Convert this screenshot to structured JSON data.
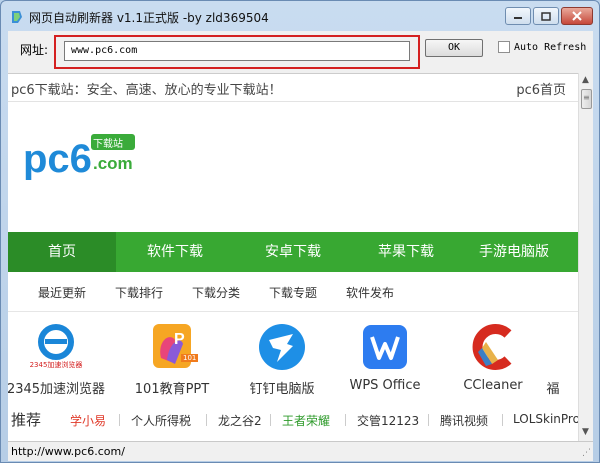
{
  "window": {
    "title": "网页自动刷新器 v1.1正式版 -by zld369504"
  },
  "toolbar": {
    "url_label": "网址:",
    "url_value": "www.pc6.com",
    "ok_label": "OK",
    "auto_refresh_label": "Auto Refresh",
    "auto_refresh_checked": false
  },
  "page": {
    "slogan": "pc6下载站：安全、高速、放心的专业下载站！",
    "home_link": "pc6首页",
    "logo": {
      "text": "pc6",
      "badge": "下载站",
      "suffix": ".com"
    },
    "nav": [
      "首页",
      "软件下载",
      "安卓下载",
      "苹果下载",
      "手游电脑版"
    ],
    "subnav": [
      "最近更新",
      "下载排行",
      "下载分类",
      "下载专题",
      "软件发布"
    ],
    "apps": [
      {
        "name": "2345加速浏览器",
        "badge": "2345加速浏览器"
      },
      {
        "name": "101教育PPT",
        "badge": "101"
      },
      {
        "name": "钉钉电脑版"
      },
      {
        "name": "WPS Office"
      },
      {
        "name": "CCleaner"
      },
      {
        "name": "福"
      }
    ],
    "tags_title": "推荐",
    "tags": [
      "学小易",
      "个人所得税",
      "龙之谷2",
      "王者荣耀",
      "交管12123",
      "腾讯视频",
      "LOLSkinPro"
    ]
  },
  "status": {
    "text": "http://www.pc6.com/"
  },
  "colors": {
    "nav_green": "#38a832",
    "highlight_red": "#d42020"
  }
}
